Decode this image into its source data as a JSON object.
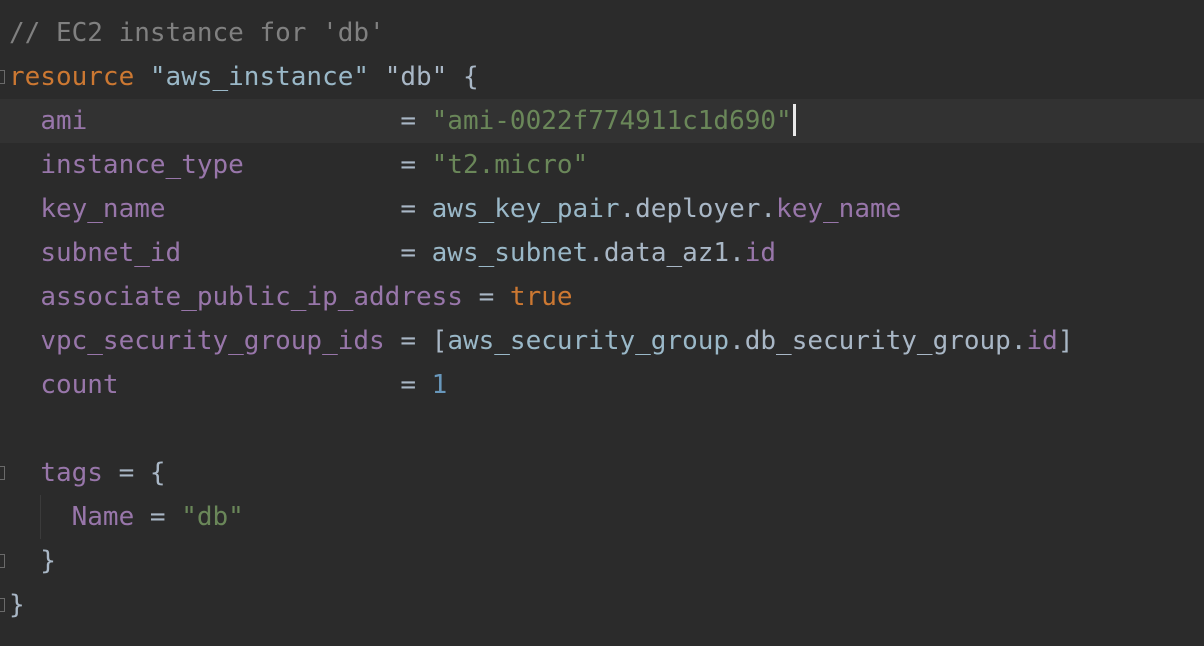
{
  "editor": {
    "lines": [
      {
        "tokens": [
          {
            "t": "// EC2 instance for 'db'",
            "c": "comment"
          }
        ]
      },
      {
        "tokens": [
          {
            "t": "resource",
            "c": "keyword"
          },
          {
            "t": " ",
            "c": "plain"
          },
          {
            "t": "\"aws_instance\"",
            "c": "rtype"
          },
          {
            "t": " ",
            "c": "plain"
          },
          {
            "t": "\"db\"",
            "c": "plain"
          },
          {
            "t": " {",
            "c": "plain"
          }
        ]
      },
      {
        "current": true,
        "tokens": [
          {
            "t": "  ",
            "c": "plain"
          },
          {
            "t": "ami",
            "c": "attr"
          },
          {
            "t": "                    = ",
            "c": "plain"
          },
          {
            "t": "\"ami-0022f774911c1d690\"",
            "c": "string"
          }
        ]
      },
      {
        "tokens": [
          {
            "t": "  ",
            "c": "plain"
          },
          {
            "t": "instance_type",
            "c": "attr"
          },
          {
            "t": "          = ",
            "c": "plain"
          },
          {
            "t": "\"t2.micro\"",
            "c": "string"
          }
        ]
      },
      {
        "tokens": [
          {
            "t": "  ",
            "c": "plain"
          },
          {
            "t": "key_name",
            "c": "attr"
          },
          {
            "t": "               = ",
            "c": "plain"
          },
          {
            "t": "aws_key_pair",
            "c": "ref"
          },
          {
            "t": ".deployer.",
            "c": "plain"
          },
          {
            "t": "key_name",
            "c": "attr"
          }
        ]
      },
      {
        "tokens": [
          {
            "t": "  ",
            "c": "plain"
          },
          {
            "t": "subnet_id",
            "c": "attr"
          },
          {
            "t": "              = ",
            "c": "plain"
          },
          {
            "t": "aws_subnet",
            "c": "ref"
          },
          {
            "t": ".data_az1.",
            "c": "plain"
          },
          {
            "t": "id",
            "c": "attr"
          }
        ]
      },
      {
        "tokens": [
          {
            "t": "  ",
            "c": "plain"
          },
          {
            "t": "associate_public_ip_address",
            "c": "attr"
          },
          {
            "t": " = ",
            "c": "plain"
          },
          {
            "t": "true",
            "c": "bool"
          }
        ]
      },
      {
        "tokens": [
          {
            "t": "  ",
            "c": "plain"
          },
          {
            "t": "vpc_security_group_ids",
            "c": "attr"
          },
          {
            "t": " = [",
            "c": "plain"
          },
          {
            "t": "aws_security_group",
            "c": "ref"
          },
          {
            "t": ".db_security_group.",
            "c": "plain"
          },
          {
            "t": "id",
            "c": "attr"
          },
          {
            "t": "]",
            "c": "plain"
          }
        ]
      },
      {
        "tokens": [
          {
            "t": "  ",
            "c": "plain"
          },
          {
            "t": "count",
            "c": "attr"
          },
          {
            "t": "                  = ",
            "c": "plain"
          },
          {
            "t": "1",
            "c": "num"
          }
        ]
      },
      {
        "tokens": []
      },
      {
        "tokens": [
          {
            "t": "  ",
            "c": "plain"
          },
          {
            "t": "tags",
            "c": "attr"
          },
          {
            "t": " = {",
            "c": "plain"
          }
        ]
      },
      {
        "tokens": [
          {
            "t": "    ",
            "c": "plain"
          },
          {
            "t": "Name",
            "c": "attr"
          },
          {
            "t": " = ",
            "c": "plain"
          },
          {
            "t": "\"db\"",
            "c": "string"
          }
        ]
      },
      {
        "tokens": [
          {
            "t": "  }",
            "c": "plain"
          }
        ]
      },
      {
        "tokens": [
          {
            "t": "}",
            "c": "plain"
          }
        ]
      }
    ],
    "caret_line": 2
  }
}
